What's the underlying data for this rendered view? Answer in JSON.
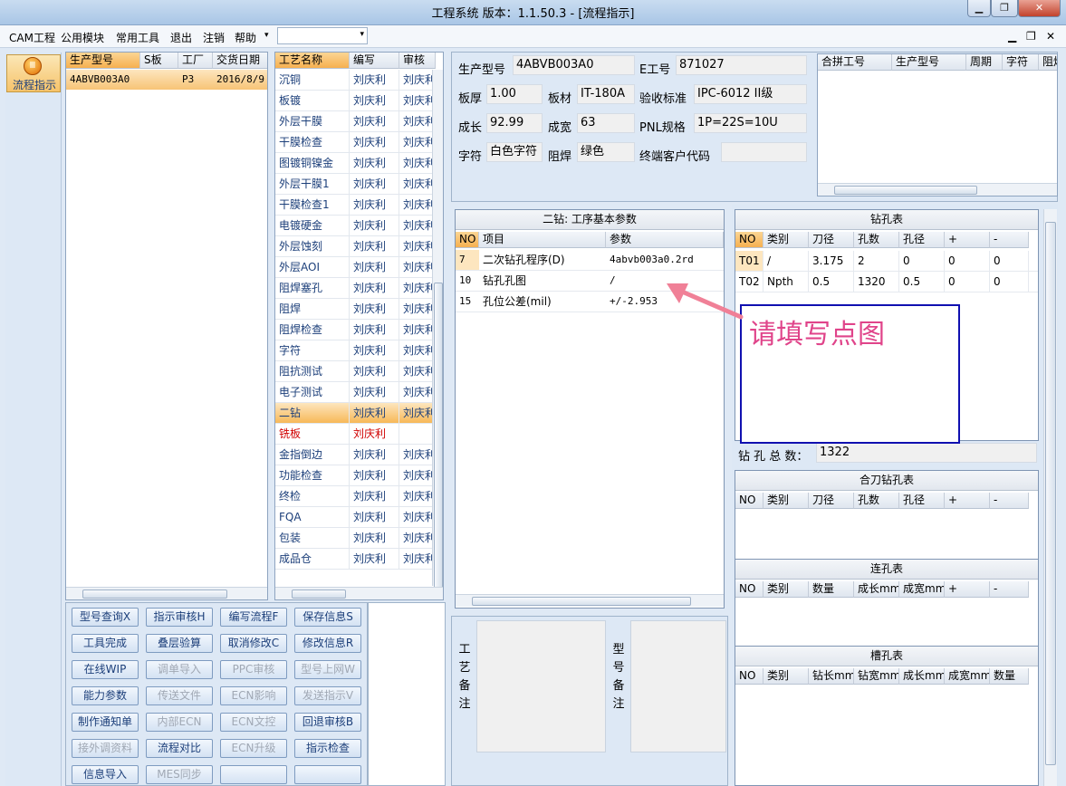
{
  "window": {
    "title": "工程系统    版本：1.1.50.3 - [流程指示]"
  },
  "menu": [
    "CAM工程",
    "公用模块",
    "常用工具",
    "退出",
    "注销",
    "帮助"
  ],
  "sidebar": {
    "flow_button": "流程指示"
  },
  "orders_table": {
    "headers": [
      "生产型号",
      "S板",
      "工厂",
      "交货日期"
    ],
    "rows": [
      [
        "4ABVB003A0",
        "",
        "P3",
        "2016/8/9"
      ]
    ]
  },
  "process_table": {
    "headers": [
      "工艺名称",
      "编写",
      "审核"
    ],
    "rows": [
      [
        "沉铜",
        "刘庆利",
        "刘庆利"
      ],
      [
        "板镀",
        "刘庆利",
        "刘庆利"
      ],
      [
        "外层干膜",
        "刘庆利",
        "刘庆利"
      ],
      [
        "干膜检查",
        "刘庆利",
        "刘庆利"
      ],
      [
        "图镀铜镍金",
        "刘庆利",
        "刘庆利"
      ],
      [
        "外层干膜1",
        "刘庆利",
        "刘庆利"
      ],
      [
        "干膜检查1",
        "刘庆利",
        "刘庆利"
      ],
      [
        "电镀硬金",
        "刘庆利",
        "刘庆利"
      ],
      [
        "外层蚀刻",
        "刘庆利",
        "刘庆利"
      ],
      [
        "外层AOI",
        "刘庆利",
        "刘庆利"
      ],
      [
        "阻焊塞孔",
        "刘庆利",
        "刘庆利"
      ],
      [
        "阻焊",
        "刘庆利",
        "刘庆利"
      ],
      [
        "阻焊检查",
        "刘庆利",
        "刘庆利"
      ],
      [
        "字符",
        "刘庆利",
        "刘庆利"
      ],
      [
        "阻抗测试",
        "刘庆利",
        "刘庆利"
      ],
      [
        "电子测试",
        "刘庆利",
        "刘庆利"
      ],
      [
        "二钻",
        "刘庆利",
        "刘庆利"
      ],
      [
        "铣板",
        "刘庆利",
        ""
      ],
      [
        "金指倒边",
        "刘庆利",
        "刘庆利"
      ],
      [
        "功能检查",
        "刘庆利",
        "刘庆利"
      ],
      [
        "终检",
        "刘庆利",
        "刘庆利"
      ],
      [
        "FQA",
        "刘庆利",
        "刘庆利"
      ],
      [
        "包装",
        "刘庆利",
        "刘庆利"
      ],
      [
        "成品仓",
        "刘庆利",
        "刘庆利"
      ]
    ],
    "selected_index": 16,
    "red_index": 17
  },
  "info": {
    "model_label": "生产型号",
    "model": "4ABVB003A0",
    "eno_label": "E工号",
    "eno": "871027",
    "thick_label": "板厚",
    "thick": "1.00",
    "material_label": "板材",
    "material": "IT-180A",
    "standard_label": "验收标准",
    "standard": "IPC-6012 II级",
    "length_label": "成长",
    "length": "92.99",
    "width_label": "成宽",
    "width": "63",
    "pnl_label": "PNL规格",
    "pnl": "1P=22S=10U",
    "char_label": "字符",
    "char": "白色字符",
    "mask_label": "阻焊",
    "mask": "绿色",
    "customer_label": "终端客户代码",
    "customer": ""
  },
  "combine_table": {
    "headers": [
      "合拼工号",
      "生产型号",
      "周期",
      "字符",
      "阻焊"
    ]
  },
  "params": {
    "title": "二钻: 工序基本参数",
    "headers": [
      "NO",
      "项目",
      "参数"
    ],
    "rows": [
      [
        "7",
        "二次钻孔程序(D)",
        "4abvb003a0.2rd"
      ],
      [
        "10",
        "钻孔孔图",
        "/"
      ],
      [
        "15",
        "孔位公差(mil)",
        "+/-2.953"
      ]
    ]
  },
  "drill": {
    "title": "钻孔表",
    "headers": [
      "NO",
      "类别",
      "刀径",
      "孔数",
      "孔径",
      "+",
      "-"
    ],
    "rows": [
      [
        "T01",
        "/",
        "3.175",
        "2",
        "0",
        "0",
        "0"
      ],
      [
        "T02",
        "Npth",
        "0.5",
        "1320",
        "0.5",
        "0",
        "0"
      ]
    ],
    "total_label": "钻 孔 总 数：",
    "total": "1322"
  },
  "annotation": {
    "text": "请填写点图",
    "color": "#e0448a"
  },
  "combo_drill": {
    "title": "合刀钻孔表",
    "headers": [
      "NO",
      "类别",
      "刀径",
      "孔数",
      "孔径",
      "+",
      "-"
    ]
  },
  "link_hole": {
    "title": "连孔表",
    "headers": [
      "NO",
      "类别",
      "数量",
      "成长mm",
      "成宽mm",
      "+",
      "-"
    ]
  },
  "slot_hole": {
    "title": "槽孔表",
    "headers": [
      "NO",
      "类别",
      "钻长mm",
      "钻宽mm",
      "成长mm",
      "成宽mm",
      "数量"
    ]
  },
  "remarks": {
    "process": "工艺备注",
    "model": "型号备注"
  },
  "buttons": [
    [
      "型号查询X",
      "指示审核H",
      "编写流程F",
      "保存信息S"
    ],
    [
      "工具完成",
      "叠层验算",
      "取消修改C",
      "修改信息R"
    ],
    [
      "在线WIP",
      "调单导入",
      "PPC审核",
      "型号上网W"
    ],
    [
      "能力参数",
      "传送文件",
      "ECN影响",
      "发送指示V"
    ],
    [
      "制作通知单",
      "内部ECN",
      "ECN文控",
      "回退审核B"
    ],
    [
      "接外调资料",
      "流程对比",
      "ECN升级",
      "指示检查"
    ],
    [
      "信息导入",
      "MES同步",
      "",
      ""
    ]
  ],
  "disabled_buttons": [
    "调单导入",
    "PPC审核",
    "型号上网W",
    "传送文件",
    "ECN影响",
    "发送指示V",
    "内部ECN",
    "ECN文控",
    "接外调资料",
    "ECN升级",
    "MES同步"
  ]
}
